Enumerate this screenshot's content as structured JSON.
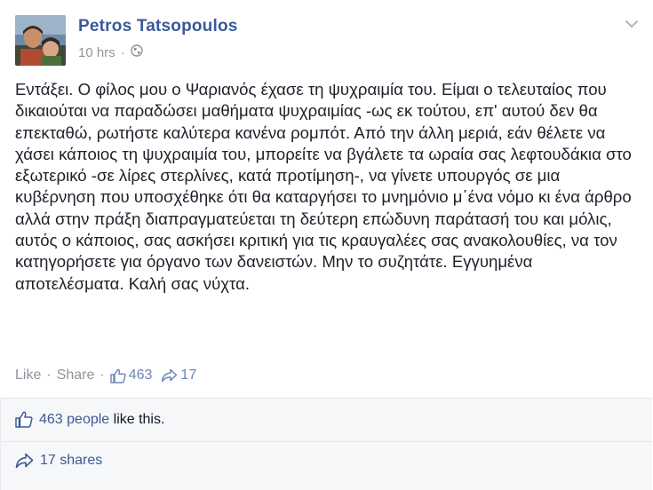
{
  "post": {
    "author": "Petros Tatsopoulos",
    "time": "10 hrs",
    "separator": "·",
    "privacy_icon": "globe-icon",
    "options_icon": "chevron-down-icon",
    "text": "Εντάξει. Ο φίλος μου ο Ψαριανός έχασε τη ψυχραιμία του. Είμαι ο τελευταίος που δικαιούται να παραδώσει μαθήματα ψυχραιμίας -ως εκ τούτου, επ' αυτού δεν θα επεκταθώ, ρωτήστε καλύτερα κανένα ρομπότ. Από την άλλη μεριά, εάν θέλετε να χάσει κάποιος τη ψυχραιμία του, μπορείτε να βγάλετε τα ωραία σας λεφτουδάκια στο εξωτερικό -σε λίρες στερλίνες, κατά προτίμηση-, να γίνετε υπουργός σε μια κυβέρνηση που υποσχέθηκε ότι θα καταργήσει το μνημόνιο μ΄ένα νόμο κι ένα άρθρο αλλά στην πράξη διαπραγματεύεται τη δεύτερη επώδυνη παράτασή του και μόλις, αυτός ο κάποιος, σας ασκήσει κριτική για τις κραυγαλέες σας ανακολουθίες, να τον κατηγορήσετε για όργανο των δανειστών. Μην το συζητάτε. Εγγυημένα αποτελέσματα. Καλή σας νύχτα."
  },
  "actions": {
    "like_label": "Like",
    "share_label": "Share",
    "dot": "·",
    "like_count": "463",
    "share_count": "17"
  },
  "summary": {
    "likes_people": "463 people",
    "likes_suffix": " like this.",
    "shares": "17 shares"
  },
  "colors": {
    "link": "#3b5998",
    "muted": "#90949c",
    "panel_bg": "#f6f7f9"
  }
}
